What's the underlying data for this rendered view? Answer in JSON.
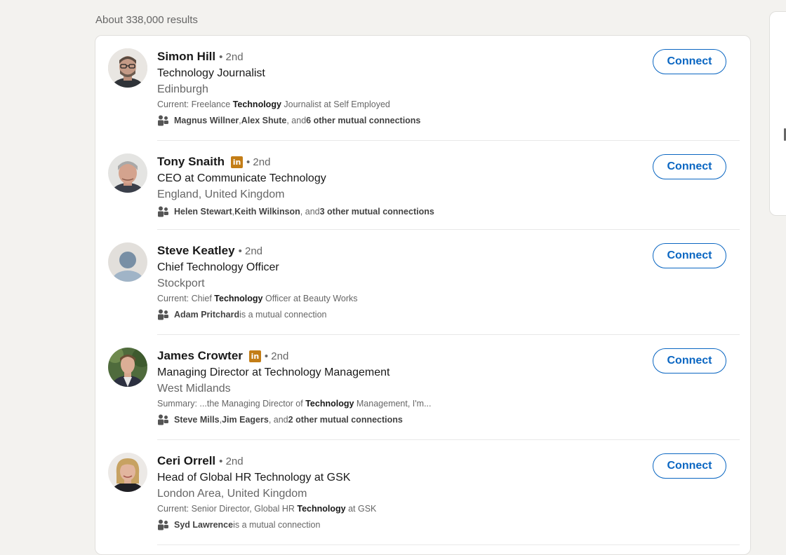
{
  "results_count": "About 338,000 results",
  "connect_label": "Connect",
  "colors": {
    "accent": "#0a66c2",
    "badge": "#c37d16",
    "muted": "#666666"
  },
  "people": [
    {
      "name": "Simon Hill",
      "linkedin_badge": false,
      "degree": "• 2nd",
      "headline": "Technology Journalist",
      "location": "Edinburgh",
      "snippet": {
        "before": "Current: Freelance ",
        "highlight": "Technology",
        "after": " Journalist at Self Employed"
      },
      "mutual": {
        "names": "Magnus Willner",
        "sep": ", ",
        "names2": "Alex Shute",
        "mid": ", and ",
        "count": "6 other mutual connections",
        "tail": ""
      },
      "avatar": "photo-man-glasses"
    },
    {
      "name": "Tony Snaith",
      "linkedin_badge": true,
      "badge_label": "in",
      "degree": "• 2nd",
      "headline": "CEO at Communicate Technology",
      "location": "England, United Kingdom",
      "snippet": null,
      "mutual": {
        "names": "Helen Stewart",
        "sep": ", ",
        "names2": "Keith Wilkinson",
        "mid": ", and ",
        "count": "3 other mutual connections",
        "tail": ""
      },
      "avatar": "photo-man-grey-hair"
    },
    {
      "name": "Steve Keatley",
      "linkedin_badge": false,
      "degree": "• 2nd",
      "headline": "Chief Technology Officer",
      "location": "Stockport",
      "snippet": {
        "before": "Current: Chief ",
        "highlight": "Technology",
        "after": " Officer at Beauty Works"
      },
      "mutual": {
        "names": "Adam Pritchard",
        "sep": "",
        "names2": "",
        "mid": "",
        "count": "",
        "tail": " is a mutual connection"
      },
      "avatar": "default-avatar"
    },
    {
      "name": "James Crowter",
      "linkedin_badge": true,
      "badge_label": "in",
      "degree": "• 2nd",
      "headline": "Managing Director at Technology Management",
      "location": "West Midlands",
      "snippet": {
        "before": "Summary: ...the Managing Director of ",
        "highlight": "Technology",
        "after": " Management, I'm..."
      },
      "mutual": {
        "names": "Steve Mills",
        "sep": ", ",
        "names2": "Jim Eagers",
        "mid": ", and ",
        "count": "2 other mutual connections",
        "tail": ""
      },
      "avatar": "photo-man-suit-outdoor"
    },
    {
      "name": "Ceri Orrell",
      "linkedin_badge": false,
      "degree": "• 2nd",
      "headline": "Head of Global HR Technology at GSK",
      "location": "London Area, United Kingdom",
      "snippet": {
        "before": "Current: Senior Director, Global HR ",
        "highlight": "Technology",
        "after": " at GSK"
      },
      "mutual": {
        "names": "Syd Lawrence",
        "sep": "",
        "names2": "",
        "mid": "",
        "count": "",
        "tail": " is a mutual connection"
      },
      "avatar": "photo-woman-blonde"
    }
  ]
}
